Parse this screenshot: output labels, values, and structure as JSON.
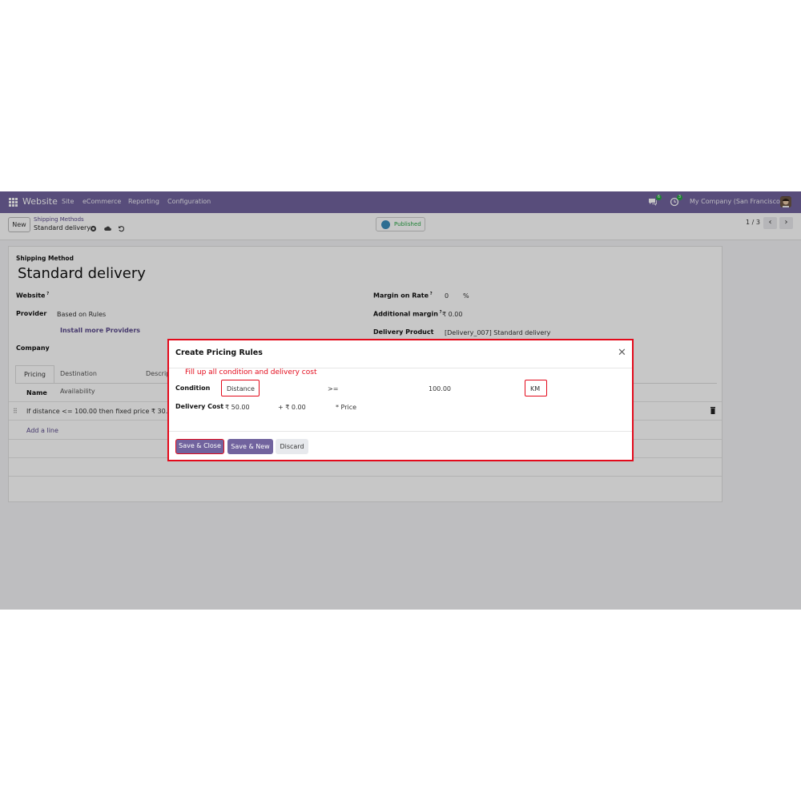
{
  "navbar": {
    "app_name": "Website",
    "menu": [
      "Site",
      "eCommerce",
      "Reporting",
      "Configuration"
    ],
    "messages_count": "6",
    "activity_count": "3",
    "company": "My Company (San Francisco)"
  },
  "control_panel": {
    "new_label": "New",
    "breadcrumb_parent": "Shipping Methods",
    "breadcrumb_current": "Standard delivery",
    "published_label": "Published",
    "pager": "1 / 3"
  },
  "form": {
    "section_label": "Shipping Method",
    "title": "Standard delivery",
    "website_label": "Website",
    "provider_label": "Provider",
    "provider_value": "Based on Rules",
    "install_providers_link": "Install more Providers",
    "company_label": "Company",
    "margin_rate_label": "Margin on Rate",
    "margin_rate_value": "0",
    "margin_rate_unit": "%",
    "additional_margin_label": "Additional margin",
    "additional_margin_value": "₹ 0.00",
    "delivery_product_label": "Delivery Product",
    "delivery_product_value": "[Delivery_007] Standard delivery",
    "tabs": [
      "Pricing",
      "Destination Availability",
      "Descrip"
    ],
    "col_name": "Name",
    "rule_row": "If distance <= 100.00 then fixed price ₹ 30.00",
    "add_line": "Add a line"
  },
  "dialog": {
    "title": "Create Pricing Rules",
    "hint": "Fill up all condition and delivery cost",
    "condition_label": "Condition",
    "condition_variable": "Distance",
    "condition_operator": ">=",
    "condition_value": "100.00",
    "condition_unit": "KM",
    "delivery_cost_label": "Delivery Cost",
    "list_base_price": "₹ 50.00",
    "list_price": "+ ₹ 0.00",
    "multiplier": "* Price",
    "save_close": "Save & Close",
    "save_new": "Save & New",
    "discard": "Discard"
  },
  "colors": {
    "brand": "#71639e",
    "highlight": "#e30a1b",
    "badge": "#28a745"
  }
}
